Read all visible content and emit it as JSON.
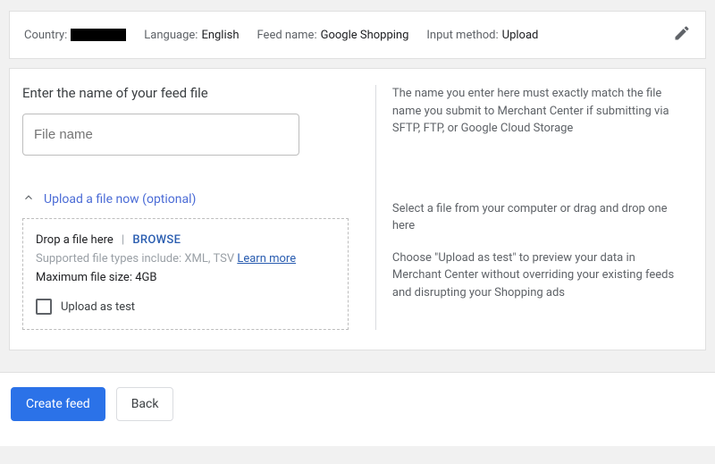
{
  "summary": {
    "country_label": "Country:",
    "language_label": "Language:",
    "language_value": "English",
    "feed_label": "Feed name:",
    "feed_value": "Google Shopping",
    "input_label": "Input method:",
    "input_value": "Upload"
  },
  "filename_section": {
    "title": "Enter the name of your feed file",
    "placeholder": "File name",
    "help": "The name you enter here must exactly match the file name you submit to Merchant Center if submitting via SFTP, FTP, or Google Cloud Storage"
  },
  "upload_section": {
    "toggle": "Upload a file now (optional)",
    "drop_text": "Drop a file here",
    "browse": "BROWSE",
    "hint_prefix": "Supported file types include: XML, TSV ",
    "learn_more": "Learn more",
    "max_size": "Maximum file size: 4GB",
    "upload_as_test": "Upload as test",
    "help1": "Select a file from your computer or drag and drop one here",
    "help2": "Choose \"Upload as test\" to preview your data in Merchant Center without overriding your existing feeds and disrupting your Shopping ads"
  },
  "footer": {
    "create": "Create feed",
    "back": "Back"
  }
}
